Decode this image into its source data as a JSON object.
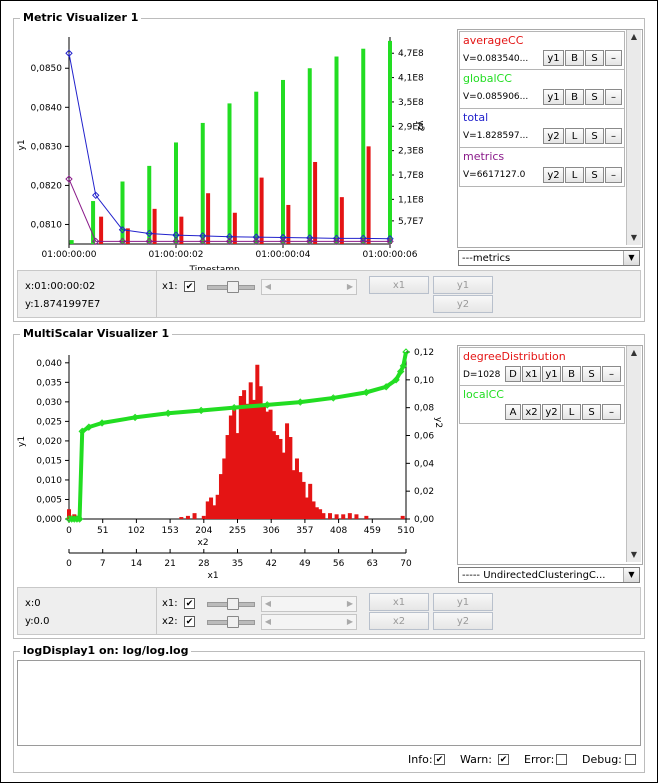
{
  "metric": {
    "title": "Metric Visualizer 1",
    "y1_ticks": [
      "0,0850",
      "0,0840",
      "0,0830",
      "0,0820",
      "0,0810"
    ],
    "y2_ticks": [
      "4,7E8",
      "4,1E8",
      "3,5E8",
      "2,9E8",
      "2,3E8",
      "1,7E8",
      "1,1E8",
      "5,7E7"
    ],
    "x_ticks": [
      "01:00:00:00",
      "01:00:00:02",
      "01:00:00:04",
      "01:00:00:06"
    ],
    "y1_label": "y1",
    "y2_label": "y2",
    "x_label": "Timestamp",
    "series": [
      {
        "name": "averageCC",
        "value": "V=0.083540...",
        "axis": "y1",
        "mode": "B",
        "color": "#e41414"
      },
      {
        "name": "globalCC",
        "value": "V=0.085906...",
        "axis": "y1",
        "mode": "B",
        "color": "#22dd22"
      },
      {
        "name": "total",
        "value": "V=1.828597...",
        "axis": "y2",
        "mode": "L",
        "color": "#2222cc"
      },
      {
        "name": "metrics",
        "value": "V=6617127.0",
        "axis": "y2",
        "mode": "L",
        "color": "#8a1a8a"
      }
    ],
    "btn_s": "S",
    "btn_minus": "–",
    "combo": "---metrics",
    "x_readout": "x:01:00:00:02",
    "y_readout": "y:1.8741997E7",
    "x1_label": "x1:",
    "check_mark": "✔",
    "buttons": {
      "x1": "x1",
      "y1": "y1",
      "y2": "y2"
    }
  },
  "multiscalar": {
    "title": "MultiScalar Visualizer 1",
    "y1_ticks": [
      "0,040",
      "0,035",
      "0,030",
      "0,025",
      "0,020",
      "0,015",
      "0,010",
      "0,005",
      "0,000"
    ],
    "y2_ticks": [
      "0,12",
      "0,10",
      "0,08",
      "0,06",
      "0,04",
      "0,02",
      "0,00"
    ],
    "x2_ticks": [
      "0",
      "51",
      "102",
      "153",
      "204",
      "255",
      "306",
      "357",
      "408",
      "459",
      "510"
    ],
    "x1_ticks": [
      "0",
      "7",
      "14",
      "21",
      "28",
      "35",
      "42",
      "49",
      "56",
      "63",
      "70"
    ],
    "x2_label": "x2",
    "x1_label_axis": "x1",
    "y1_label": "y1",
    "y2_label": "y2",
    "series": [
      {
        "name": "degreeDistribution",
        "value": "D=1028",
        "color": "#e41414",
        "buttons": [
          "D",
          "x1",
          "y1",
          "B",
          "S",
          "–"
        ]
      },
      {
        "name": "localCC",
        "value": "",
        "color": "#22dd22",
        "buttons": [
          "A",
          "x2",
          "y2",
          "L",
          "S",
          "–"
        ]
      }
    ],
    "combo": "----- UndirectedClusteringC...",
    "x_readout": "x:0",
    "y_readout": "y:0.0",
    "x1_ctl": "x1:",
    "x2_ctl": "x2:",
    "check_mark": "✔",
    "buttons": {
      "x1": "x1",
      "y1": "y1",
      "x2": "x2",
      "y2": "y2"
    }
  },
  "log": {
    "title": "logDisplay1 on: log/log.log",
    "info": "Info:",
    "warn": "Warn:",
    "error": "Error:",
    "debug": "Debug:",
    "check_mark": "✔"
  },
  "chart_data": [
    {
      "type": "bar",
      "title": "Metric Visualizer 1",
      "xlabel": "Timestamp",
      "ylabel": "y1",
      "y2label": "y2",
      "ylim": [
        0.0805,
        0.0858
      ],
      "x_ticks": [
        "01:00:00:00",
        "01:00:00:02",
        "01:00:00:04",
        "01:00:00:06"
      ],
      "series": [
        {
          "name": "averageCC",
          "axis": "y1",
          "type": "bar",
          "x": [
            0.6,
            1.1,
            1.6,
            2.1,
            2.6,
            3.1,
            3.6,
            4.1,
            4.6,
            5.1,
            5.6
          ],
          "values": [
            0.0812,
            0.0809,
            0.0814,
            0.0812,
            0.0818,
            0.0813,
            0.0822,
            0.0815,
            0.0826,
            0.0817,
            0.083
          ]
        },
        {
          "name": "globalCC",
          "axis": "y1",
          "type": "bar",
          "x": [
            0.05,
            0.45,
            1.0,
            1.5,
            2.0,
            2.5,
            3.0,
            3.5,
            4.0,
            4.5,
            5.0,
            5.5,
            6.0
          ],
          "values": [
            0.0806,
            0.0816,
            0.0821,
            0.0825,
            0.0831,
            0.0836,
            0.0841,
            0.0844,
            0.0847,
            0.085,
            0.0853,
            0.0855,
            0.0857
          ]
        },
        {
          "name": "total",
          "axis": "y2",
          "type": "line",
          "x": [
            0,
            0.5,
            1,
            1.5,
            2,
            2.5,
            3,
            3.5,
            4,
            4.5,
            5,
            5.5,
            6
          ],
          "values": [
            470000000.0,
            120000000.0,
            35000000.0,
            26000000.0,
            22000000.0,
            20000000.0,
            18000000.0,
            17000000.0,
            16000000.0,
            15000000.0,
            14000000.0,
            14000000.0,
            13000000.0
          ]
        },
        {
          "name": "metrics",
          "axis": "y2",
          "type": "line",
          "x": [
            0,
            0.5,
            1,
            1.5,
            2,
            2.5,
            3,
            3.5,
            4,
            4.5,
            5,
            5.5,
            6
          ],
          "values": [
            160000000.0,
            6600000.0,
            6600000.0,
            6600000.0,
            6600000.0,
            6600000.0,
            6600000.0,
            6600000.0,
            6600000.0,
            6600000.0,
            6600000.0,
            6600000.0,
            6600000.0
          ]
        }
      ]
    },
    {
      "type": "bar",
      "title": "MultiScalar Visualizer 1",
      "xlabel": "x2",
      "ylabel": "y1",
      "y2label": "y2",
      "ylim": [
        0,
        0.042
      ],
      "y2lim": [
        0,
        0.12
      ],
      "x2lim": [
        0,
        510
      ],
      "x1lim": [
        0,
        70
      ],
      "series": [
        {
          "name": "degreeDistribution",
          "axis": "y1",
          "type": "bar",
          "x": [
            0,
            4,
            8,
            12,
            16,
            170,
            180,
            190,
            204,
            210,
            215,
            220,
            225,
            230,
            235,
            240,
            245,
            250,
            255,
            260,
            265,
            270,
            275,
            280,
            285,
            290,
            295,
            300,
            305,
            310,
            315,
            320,
            325,
            330,
            335,
            340,
            345,
            350,
            355,
            360,
            365,
            370,
            375,
            380,
            385,
            395,
            405,
            415,
            425,
            435,
            450,
            505
          ],
          "values": [
            0.0025,
            0.0005,
            0.0012,
            0.0008,
            0.0005,
            0.0005,
            0.0008,
            0.0015,
            0.0008,
            0.0045,
            0.0055,
            0.0035,
            0.0062,
            0.0115,
            0.0155,
            0.0215,
            0.0265,
            0.0285,
            0.022,
            0.0315,
            0.033,
            0.0295,
            0.035,
            0.0305,
            0.0395,
            0.034,
            0.029,
            0.0275,
            0.028,
            0.0225,
            0.0215,
            0.0205,
            0.017,
            0.0245,
            0.021,
            0.0125,
            0.0155,
            0.012,
            0.0095,
            0.0055,
            0.009,
            0.0045,
            0.003,
            0.0025,
            0.0015,
            0.0015,
            0.0012,
            0.0012,
            0.0015,
            0.0012,
            0.0008,
            0.0008
          ]
        },
        {
          "name": "localCC",
          "axis": "y2",
          "type": "line",
          "x": [
            0,
            4,
            8,
            12,
            16,
            20,
            30,
            50,
            100,
            150,
            200,
            250,
            300,
            350,
            400,
            450,
            480,
            495,
            502,
            506,
            510
          ],
          "values": [
            0.0,
            0.0,
            0.0,
            0.0,
            0.0,
            0.063,
            0.066,
            0.069,
            0.073,
            0.076,
            0.078,
            0.08,
            0.082,
            0.084,
            0.087,
            0.091,
            0.095,
            0.1,
            0.106,
            0.11,
            0.12
          ]
        }
      ]
    }
  ]
}
